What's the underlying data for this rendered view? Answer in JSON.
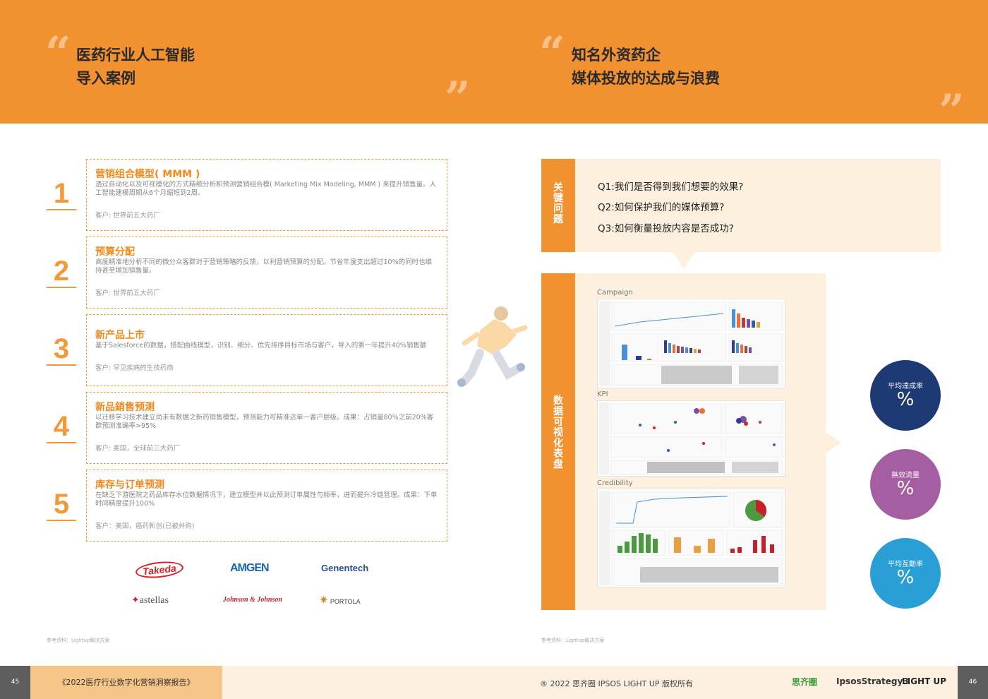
{
  "header": {
    "left_title_line1": "医药行业人工智能",
    "left_title_line2": "导入案例",
    "right_title_line1": "知名外资药企",
    "right_title_line2": "媒体投放的达成与浪费"
  },
  "cases": [
    {
      "num": "1",
      "title": "营销组合模型( MMM )",
      "desc": "透过自动化以及可视模化的方式精细分析和预测营销组合模( Marketing Mix Modeling, MMM ) 来提升销售量。人工智能建模周期从6个月缩短到2周。",
      "client": "客户:  世界前五大药厂"
    },
    {
      "num": "2",
      "title": "预算分配",
      "desc": "高度精准地分析不同的微分众客群对于营销策略的反馈，以利营销预算的分配。节省年度支出超过10%的同时也维持甚至增加销售量。",
      "client": "客户:  世界前五大药厂"
    },
    {
      "num": "3",
      "title": "新产品上市",
      "desc": "基于Salesforce的数据，搭配曲线模型，识别、细分、优先排序目标市场与客户，导入的第一年提升40%销售额",
      "client": "客户:  罕见疾病的生技药商"
    },
    {
      "num": "4",
      "title": "新品銷售预测",
      "desc": "以迁移学习技术建立尚未有数据之新药销售模型，预测能力可精准达单一客户层级。成果：占销量80%之前20%客群预测准确率>95%",
      "client": "客户:  美国，全球前三大药厂"
    },
    {
      "num": "5",
      "title": "库存与订单预测",
      "desc": "在缺乏下游医院之药品库存水位数据情况下，建立模型并以此预测订单属性与频率，进而提升冷链管理。成果：下单时间精度提升100%",
      "client": "客户：美国，癌药新创(已被并购)"
    }
  ],
  "logos": {
    "takeda": "Takeda",
    "amgen": "AMGEN",
    "genentech": "Genentech",
    "astellas": "astellas",
    "jnj": "Johnson & Johnson",
    "portola": "PORTOLA"
  },
  "reference_left": "参考资料：Lightup解决方案",
  "reference_right": "参考资料：Lightup解决方案",
  "key_questions": {
    "label": "关键问题",
    "items": [
      "Q1:我们是否得到我们想要的效果?",
      "Q2:如何保护我们的媒体预算?",
      "Q3:如何衡量投放内容是否成功?"
    ]
  },
  "dashboard": {
    "label": "数据可视化表盘",
    "sections": [
      "Campaign",
      "KPI",
      "Credibility"
    ]
  },
  "metrics": [
    {
      "label": "平均達成率",
      "value": "%",
      "color": "#1d3a75"
    },
    {
      "label": "無效流量",
      "value": "%",
      "color": "#a65ea2"
    },
    {
      "label": "平均互動率",
      "value": "%",
      "color": "#2a9fd6"
    }
  ],
  "footer": {
    "page_left": "45",
    "report": "《2022医疗行业数字化营销洞察报告》",
    "copyright": "® 2022 思齐圈 IPSOS LIGHT UP 版权所有",
    "brand1": "思齐圈",
    "brand2": "IpsosStrategy3",
    "brand3": "LIGHT UP",
    "page_right": "46"
  }
}
